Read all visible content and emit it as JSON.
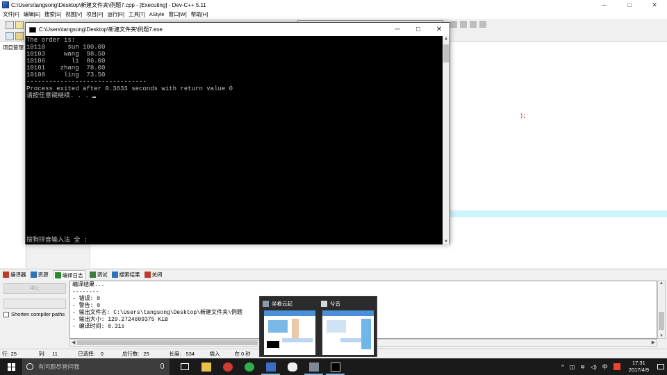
{
  "window": {
    "title": "C:\\Users\\tangsong\\Desktop\\新建文件夹\\例题7.cpp - [Executing] - Dev-C++ 5.11",
    "min": "─",
    "max": "□",
    "close": "✕"
  },
  "menu": [
    "文件[F]",
    "编辑[E]",
    "搜索[S]",
    "视图[V]",
    "项目[P]",
    "运行[R]",
    "工具[T]",
    "AStyle",
    "窗口[W]",
    "帮助[H]"
  ],
  "left_panel": {
    "title": "项目管理"
  },
  "editor": {
    "red_fragment": ");"
  },
  "console": {
    "title": "C:\\Users\\tangsong\\Desktop\\新建文件夹\\例题7.exe",
    "min": "─",
    "max": "□",
    "close": "✕",
    "lines": [
      "The order is:",
      "10110      sun 100.00",
      "10103     wang  98.50",
      "10106       li  86.00",
      "10101    zhang  78.00",
      "10108     ling  73.50",
      "",
      "",
      "--------------------------------",
      "Process exited after 0.3633 seconds with return value 0",
      "请按任意键继续. . . "
    ],
    "ime": "搜狗拼音输入法 全 :"
  },
  "bottom_tabs": [
    {
      "label": "编译器",
      "color": "#c0392b"
    },
    {
      "label": "资源",
      "color": "#2f6fbf"
    },
    {
      "label": "编译日志",
      "color": "#2a8a2a"
    },
    {
      "label": "调试",
      "color": "#3a7a3a"
    },
    {
      "label": "搜索结果",
      "color": "#2f6fbf"
    },
    {
      "label": "关闭",
      "color": "#c0392b"
    }
  ],
  "compile_panel": {
    "abort_label": "中止",
    "checkbox_label": "Shorten compiler paths"
  },
  "log": {
    "lines": [
      "编译结果...",
      "--------",
      "- 错误: 0",
      "- 警告: 0",
      "- 输出文件名: C:\\Users\\tangsong\\Desktop\\新建文件夹\\例题",
      "- 输出大小: 129.2724609375 KiB",
      "- 编译时间: 0.31s"
    ]
  },
  "status": {
    "row_label": "行:",
    "row": "25",
    "col_label": "列:",
    "col": "11",
    "sel_label": "已选择:",
    "sel": "0",
    "lines_label": "总行数:",
    "lines": "25",
    "len_label": "长度:",
    "len": "534",
    "mode": "插入",
    "info": "在 0 秒"
  },
  "thumbnails": [
    {
      "title": "坐看云起"
    },
    {
      "title": "兮音"
    }
  ],
  "taskbar": {
    "search_placeholder": "有问题尽管问我",
    "apps": [
      "task-view",
      "file-explorer",
      "netease-music",
      "browser",
      "devcpp",
      "qq-penguin",
      "chat-app",
      "console-app"
    ],
    "tray": {
      "ime": "中",
      "time": "17:31",
      "date": "2017/4/9"
    }
  },
  "colors": {
    "console_bg": "#000000",
    "console_text": "#c0c0c0",
    "current_line": "#cff4fb",
    "taskbar": "#1a1a1a",
    "search_box": "#3c3c3c"
  }
}
